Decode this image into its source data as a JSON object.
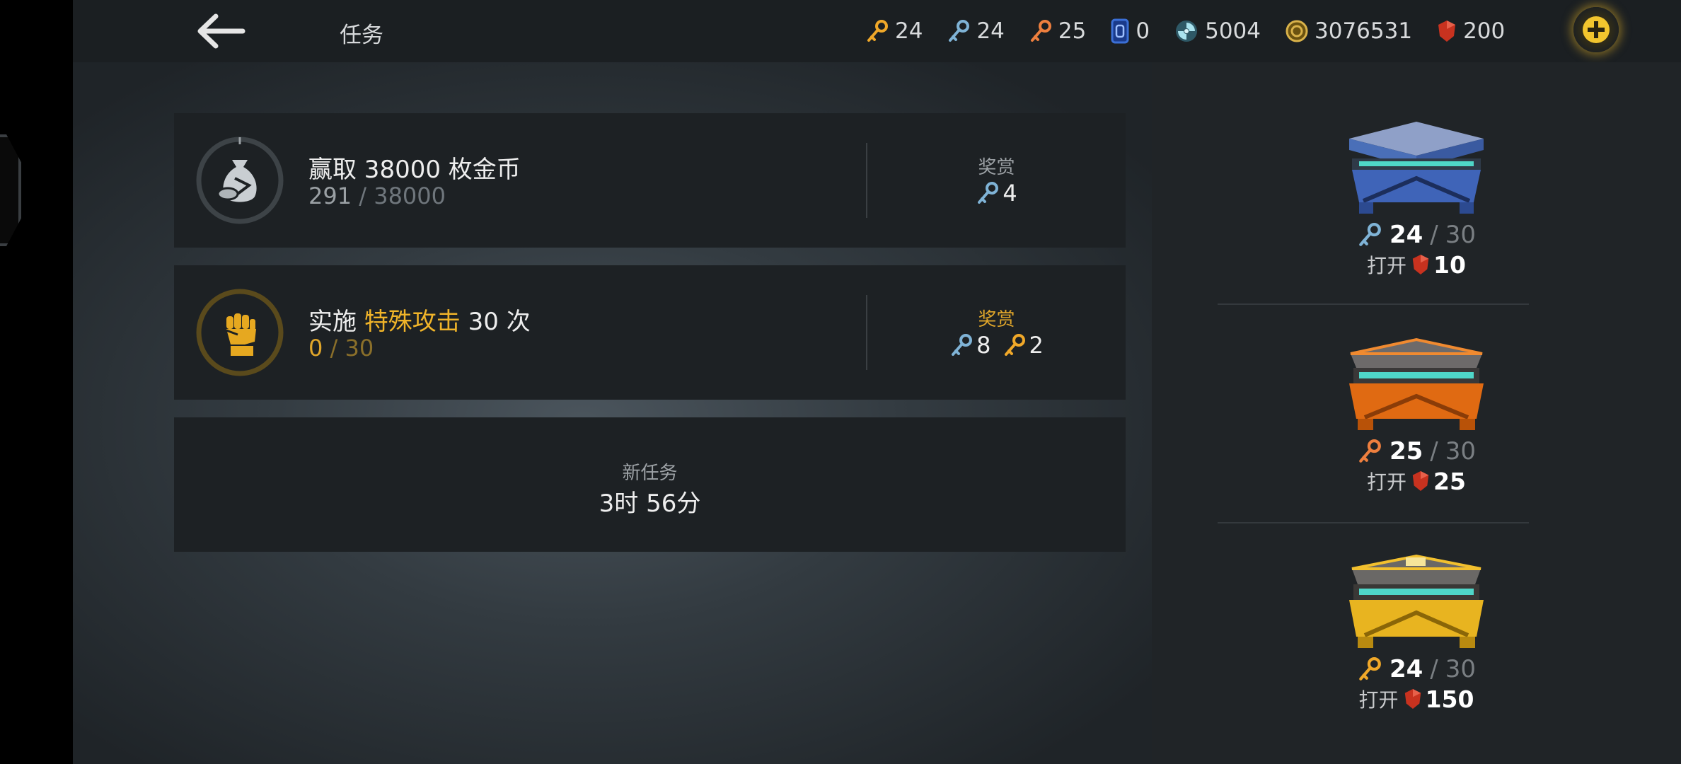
{
  "header": {
    "title": "任务",
    "currencies": [
      {
        "icon": "gold-key-icon",
        "color": "#f0a829",
        "value": "24"
      },
      {
        "icon": "blue-key-icon",
        "color": "#7fb3d6",
        "value": "24"
      },
      {
        "icon": "orange-key-icon",
        "color": "#ee7f3e",
        "value": "25"
      },
      {
        "icon": "card-icon",
        "color": "#3b6fd6",
        "value": "0"
      },
      {
        "icon": "energy-orb-icon",
        "color": "#7fc8d6",
        "value": "5004"
      },
      {
        "icon": "coin-icon",
        "color": "#d9b24a",
        "value": "3076531"
      },
      {
        "icon": "ruby-icon",
        "color": "#d23a2a",
        "value": "200"
      }
    ]
  },
  "tasks": [
    {
      "title": "赢取 38000 枚金币",
      "progress_current": "291",
      "progress_sep": " / ",
      "progress_max": "38000",
      "reward_label": "奖赏",
      "reward_1": "4"
    },
    {
      "title_prefix": "实施 ",
      "title_highlight": "特殊攻击",
      "title_suffix": " 30 次",
      "progress_current": "0",
      "progress_sep": " / ",
      "progress_max": "30",
      "reward_label": "奖赏",
      "reward_1": "8",
      "reward_2": "2"
    }
  ],
  "new_task": {
    "label": "新任务",
    "timer": "3时 56分"
  },
  "chests": [
    {
      "current": "24",
      "sep": "/",
      "max": "30",
      "open_label": "打开",
      "price": "10",
      "key_color": "#7fb3d6"
    },
    {
      "current": "25",
      "sep": "/",
      "max": "30",
      "open_label": "打开",
      "price": "25",
      "key_color": "#ee7f3e"
    },
    {
      "current": "24",
      "sep": "/",
      "max": "30",
      "open_label": "打开",
      "price": "150",
      "key_color": "#f0a829"
    }
  ],
  "colors": {
    "highlight": "#f0b429",
    "muted": "#6f767c",
    "gold_muted": "#8a6f2a"
  }
}
